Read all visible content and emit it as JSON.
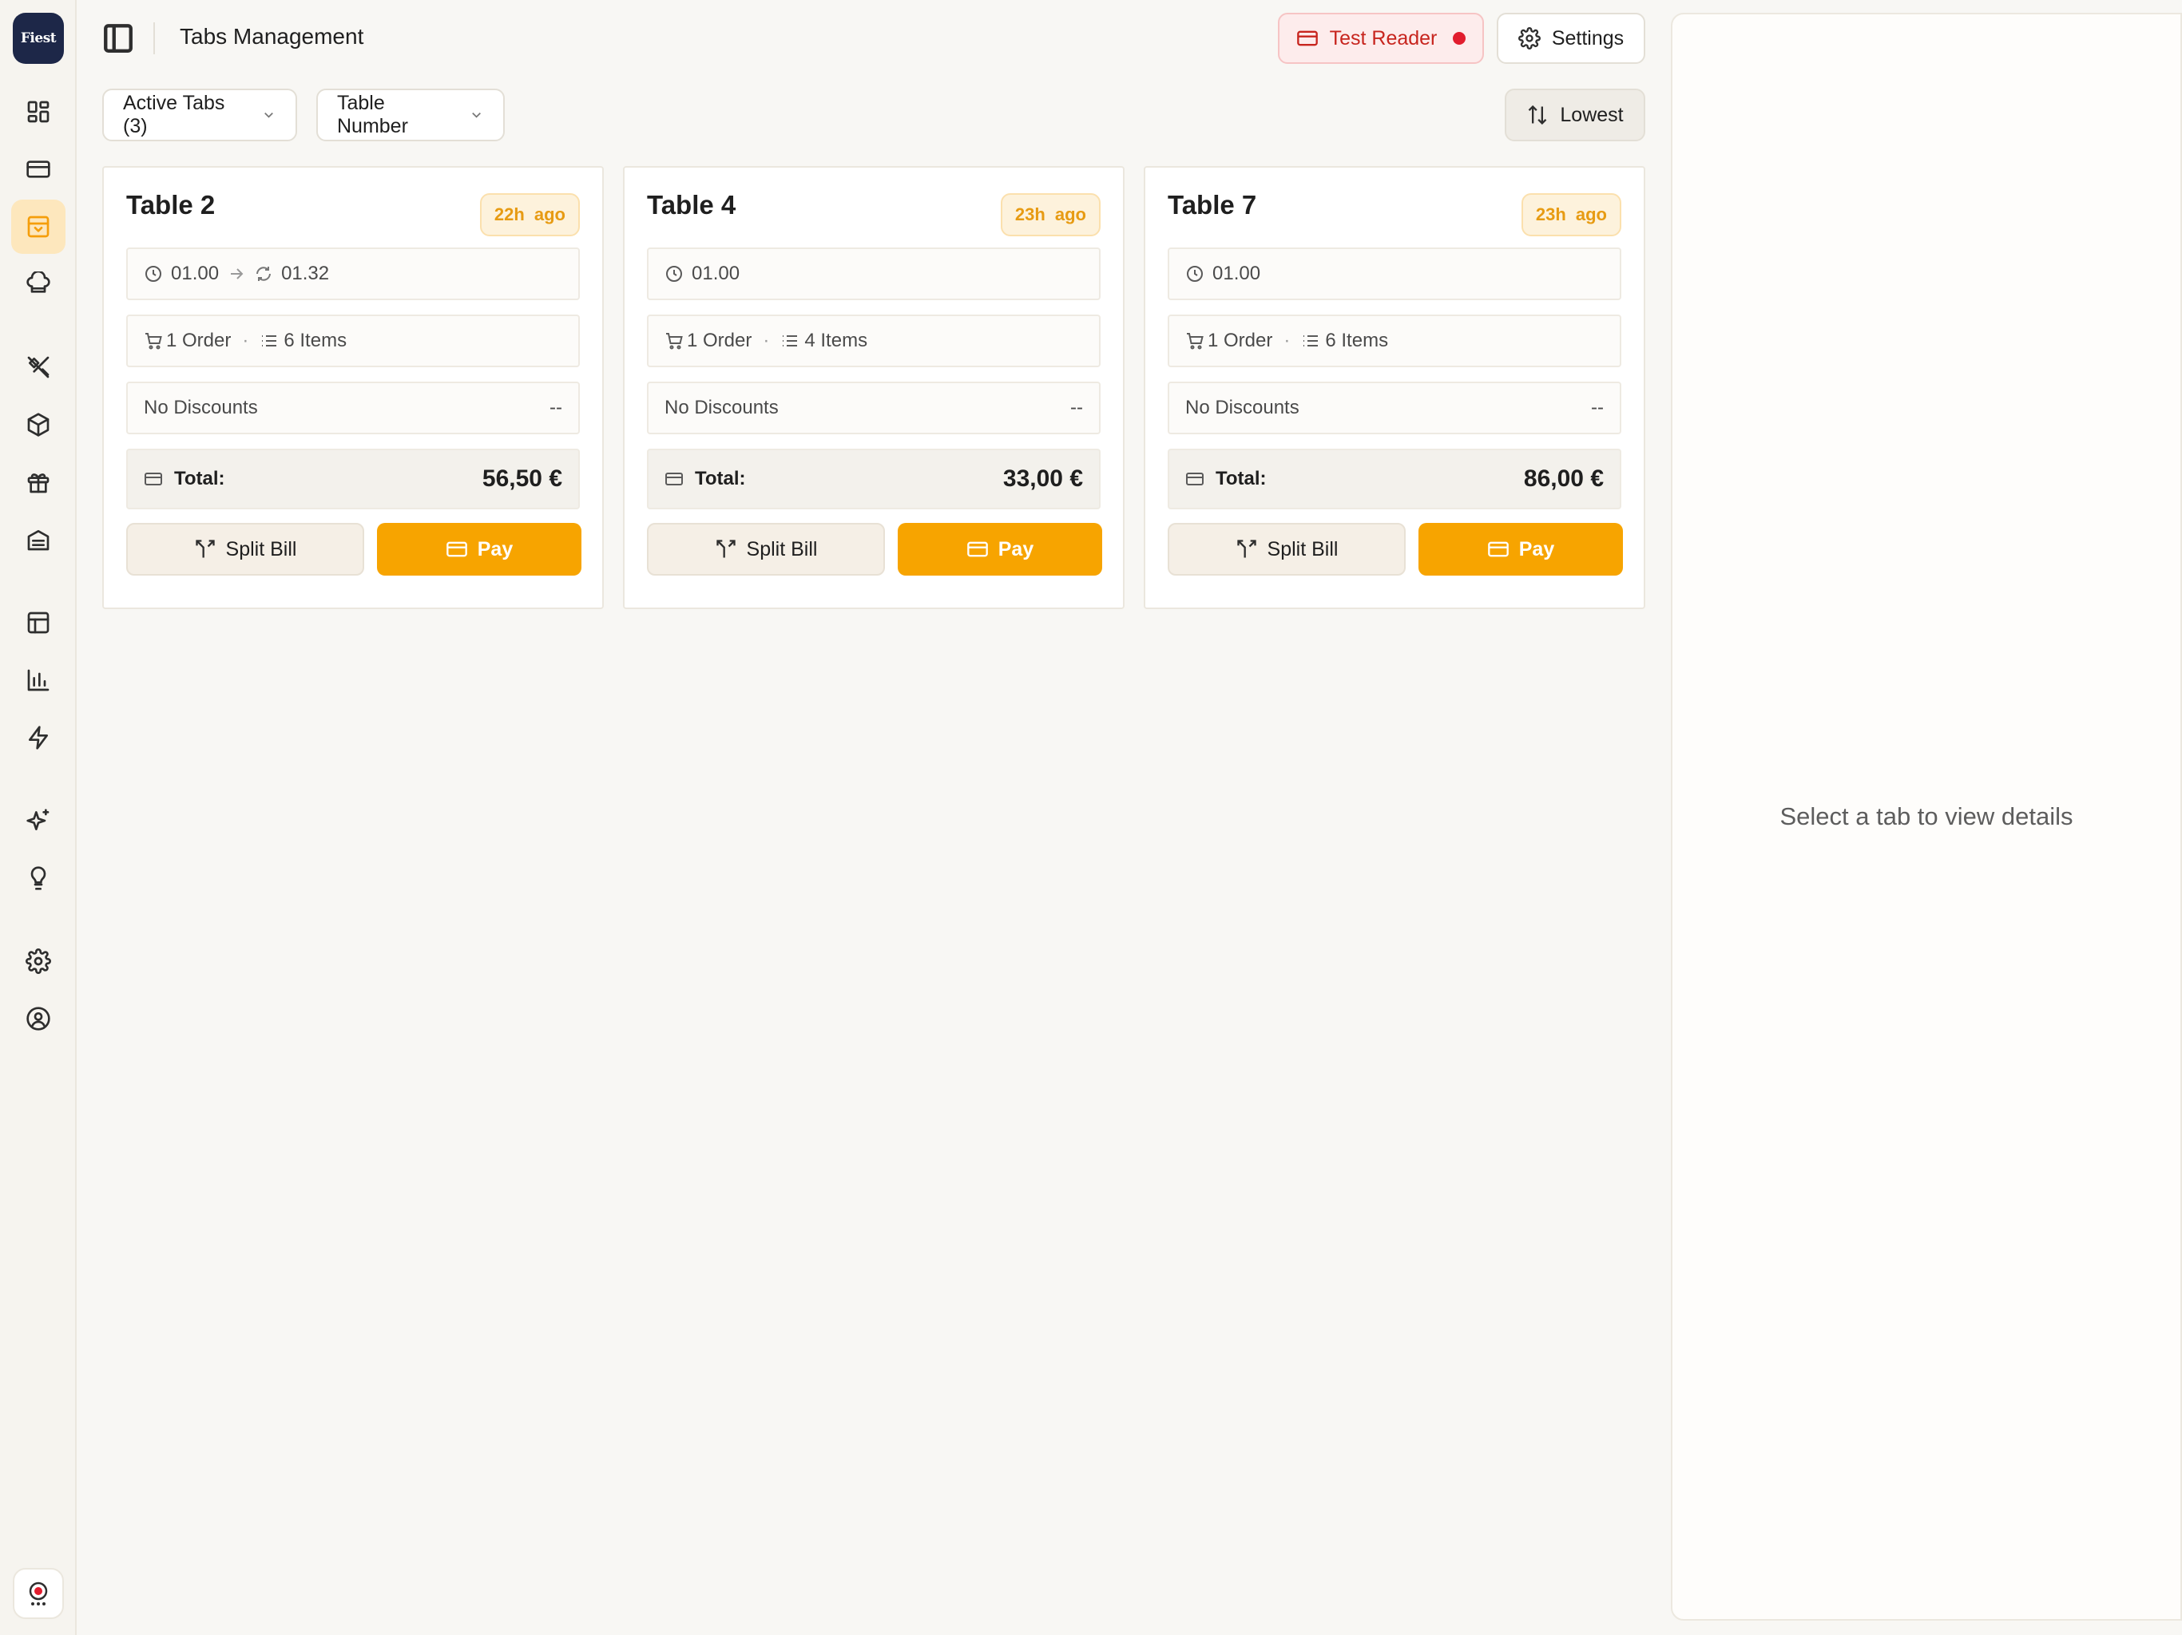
{
  "app": {
    "logo_text": "Fiest",
    "colors": {
      "accent": "#f7a400",
      "sidebar_active": "#fde7bd",
      "reader_red": "#c7251e",
      "logo_bg": "#1d2748"
    }
  },
  "sidebar": {
    "items": [
      {
        "icon": "dashboard-icon"
      },
      {
        "icon": "card-icon"
      },
      {
        "icon": "tabs-icon",
        "active": true
      },
      {
        "icon": "chef-hat-icon"
      },
      {
        "icon": "utensils-icon"
      },
      {
        "icon": "package-icon"
      },
      {
        "icon": "gift-icon"
      },
      {
        "icon": "warehouse-icon"
      },
      {
        "icon": "table-icon"
      },
      {
        "icon": "chart-icon"
      },
      {
        "icon": "zap-icon"
      },
      {
        "icon": "sparkles-icon"
      },
      {
        "icon": "lightbulb-icon"
      },
      {
        "icon": "settings-icon"
      },
      {
        "icon": "user-circle-icon"
      }
    ]
  },
  "header": {
    "title": "Tabs Management",
    "reader_label": "Test Reader",
    "settings_label": "Settings"
  },
  "filters": {
    "status_label": "Active Tabs (3)",
    "group_label": "Table Number",
    "sort_label": "Lowest"
  },
  "tabs": [
    {
      "name": "Table 2",
      "ago": "22h ago",
      "opened": "01.00",
      "updated": "01.32",
      "orders": "1 Order",
      "items": "6 Items",
      "discount_label": "No Discounts",
      "discount_value": "--",
      "total_label": "Total:",
      "total": "56,50 €",
      "split_label": "Split Bill",
      "pay_label": "Pay"
    },
    {
      "name": "Table 4",
      "ago": "23h ago",
      "opened": "01.00",
      "orders": "1 Order",
      "items": "4 Items",
      "discount_label": "No Discounts",
      "discount_value": "--",
      "total_label": "Total:",
      "total": "33,00 €",
      "split_label": "Split Bill",
      "pay_label": "Pay"
    },
    {
      "name": "Table 7",
      "ago": "23h ago",
      "opened": "01.00",
      "orders": "1 Order",
      "items": "6 Items",
      "discount_label": "No Discounts",
      "discount_value": "--",
      "total_label": "Total:",
      "total": "86,00 €",
      "split_label": "Split Bill",
      "pay_label": "Pay"
    }
  ],
  "detail": {
    "empty_text": "Select a tab to view details"
  }
}
